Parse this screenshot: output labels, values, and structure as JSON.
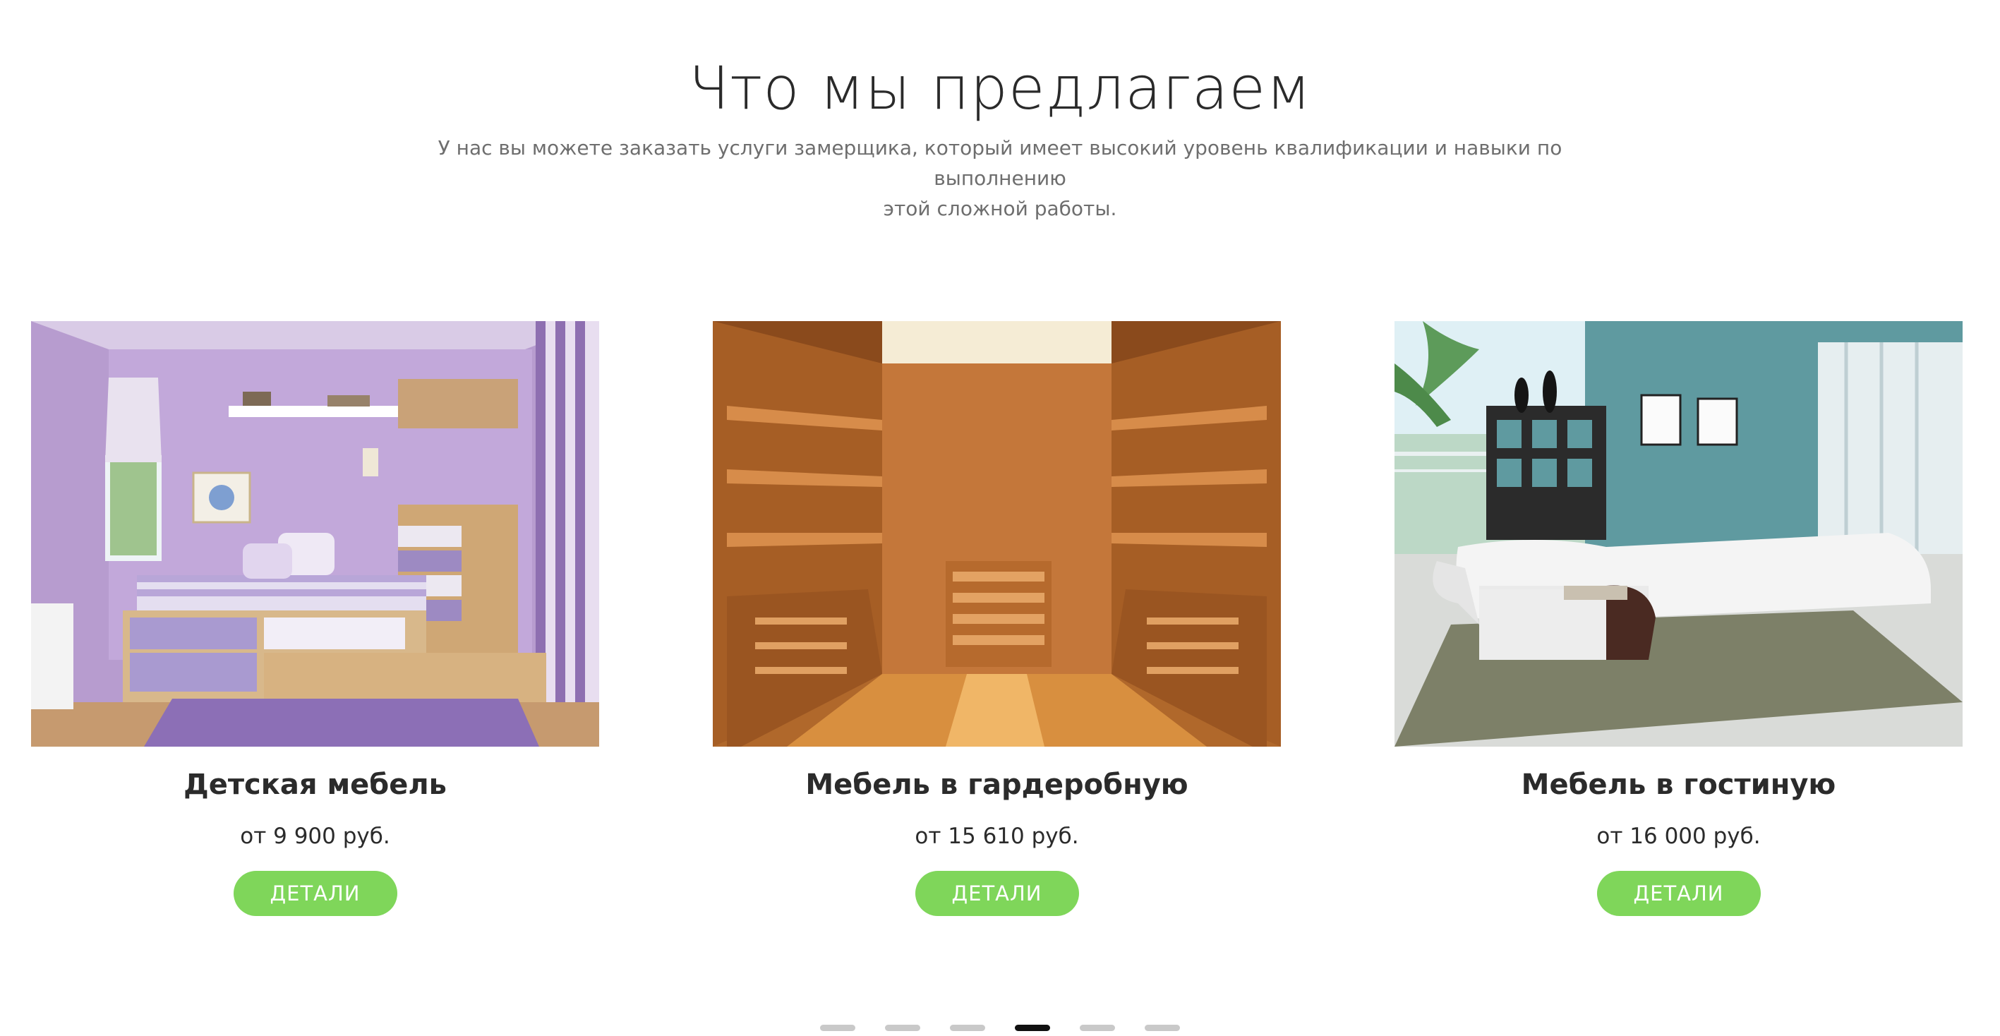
{
  "section": {
    "title": "Что мы предлагаем",
    "subtitle_line1": "У нас вы можете заказать услуги замерщика, который имеет высокий уровень квалификации и навыки по выполнению",
    "subtitle_line2": "этой сложной работы."
  },
  "cards": [
    {
      "title": "Детская мебель",
      "price": "от 9 900 руб.",
      "button": "ДЕТАЛИ"
    },
    {
      "title": "Мебель в гардеробную",
      "price": "от 15 610 руб.",
      "button": "ДЕТАЛИ"
    },
    {
      "title": "Мебель в гостиную",
      "price": "от 16 000 руб.",
      "button": "ДЕТАЛИ"
    }
  ],
  "pager": {
    "count": 6,
    "active_index": 3
  },
  "colors": {
    "accent": "#7fd65a",
    "pager_active": "#111111",
    "pager_inactive": "#c9c9c9"
  }
}
